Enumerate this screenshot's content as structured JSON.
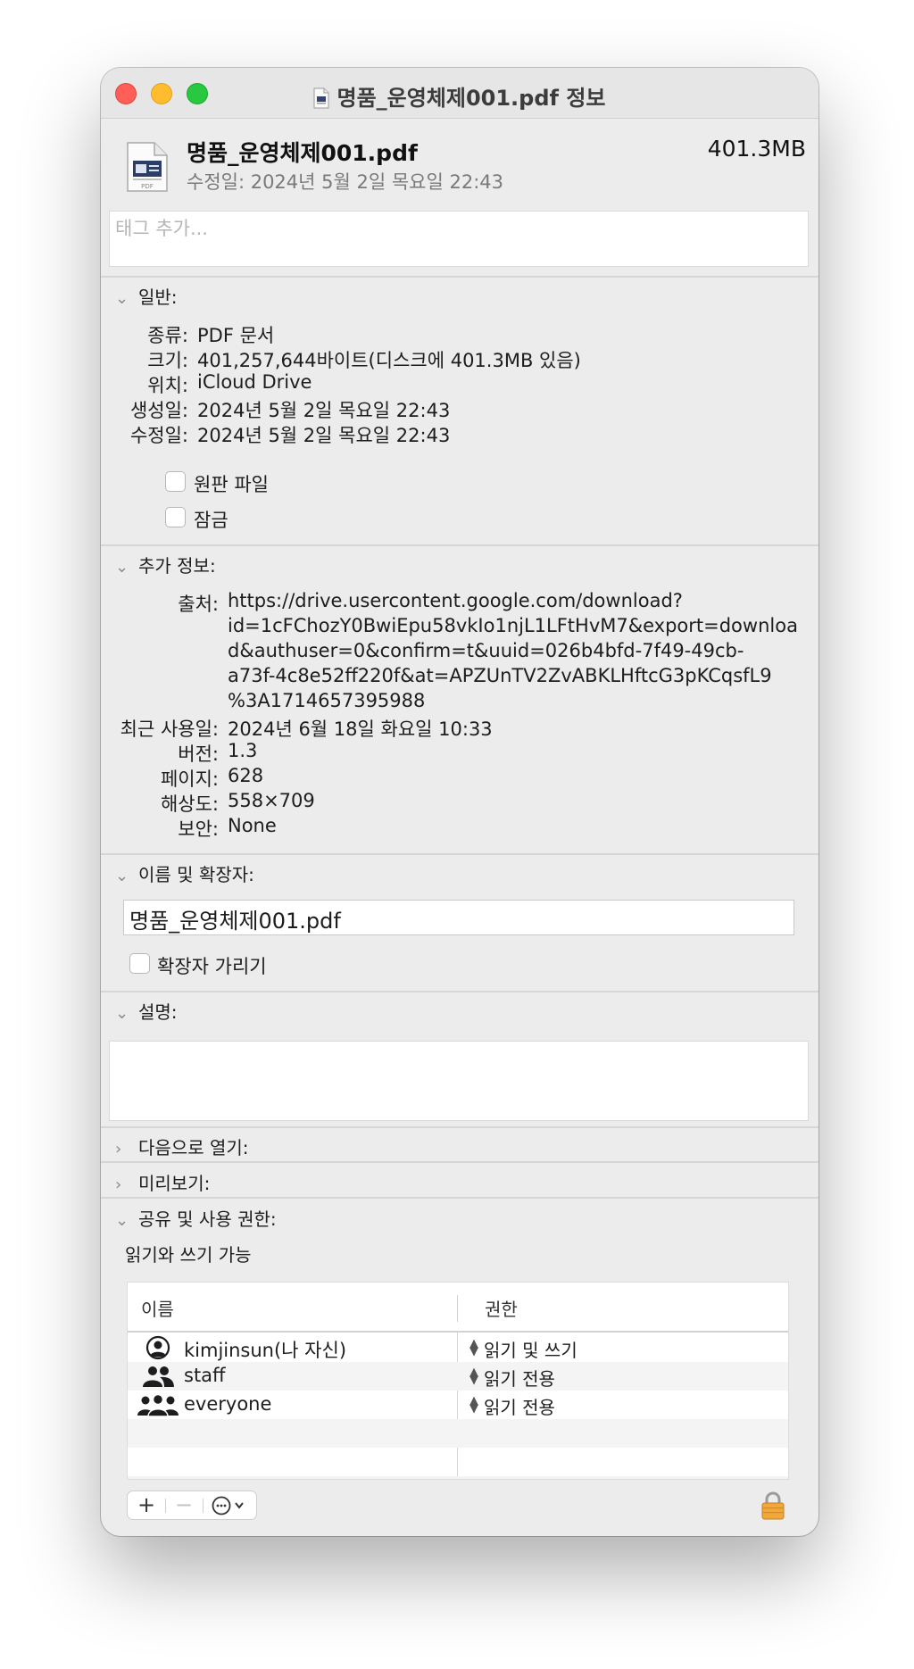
{
  "window": {
    "title": "명품_운영체제001.pdf 정보",
    "traffic_lights": [
      "close",
      "minimize",
      "zoom"
    ]
  },
  "header": {
    "file_name": "명품_운영체제001.pdf",
    "file_size": "401.3MB",
    "modified": "수정일: 2024년 5월 2일 목요일 22:43",
    "file_icon_label": "PDF"
  },
  "tags": {
    "placeholder": "태그 추가..."
  },
  "general": {
    "title": "일반:",
    "rows": [
      {
        "label": "종류:",
        "value": "PDF 문서"
      },
      {
        "label": "크기:",
        "value": "401,257,644바이트(디스크에 401.3MB 있음)"
      },
      {
        "label": "위치:",
        "value": "iCloud Drive"
      },
      {
        "label": "생성일:",
        "value": "2024년 5월 2일 목요일 22:43"
      },
      {
        "label": "수정일:",
        "value": "2024년 5월 2일 목요일 22:43"
      }
    ],
    "stationery_label": "원판 파일",
    "locked_label": "잠금"
  },
  "more_info": {
    "title": "추가 정보:",
    "source_label": "출처:",
    "source_lines": [
      "https://drive.usercontent.google.com/download?",
      "id=1cFChozY0BwiEpu58vkIo1njL1LFtHvM7&export=downloa",
      "d&authuser=0&confirm=t&uuid=026b4bfd-7f49-49cb-",
      "a73f-4c8e52ff220f&at=APZUnTV2ZvABKLHftcG3pKCqsfL9",
      "%3A1714657395988"
    ],
    "rows": [
      {
        "label": "최근 사용일:",
        "value": "2024년 6월 18일 화요일 10:33"
      },
      {
        "label": "버전:",
        "value": "1.3"
      },
      {
        "label": "페이지:",
        "value": "628"
      },
      {
        "label": "해상도:",
        "value": "558×709"
      },
      {
        "label": "보안:",
        "value": "None"
      }
    ]
  },
  "name_ext": {
    "title": "이름 및 확장자:",
    "value": "명품_운영체제001.pdf",
    "hide_ext_label": "확장자 가리기"
  },
  "comments": {
    "title": "설명:"
  },
  "open_with": {
    "title": "다음으로 열기:"
  },
  "preview": {
    "title": "미리보기:"
  },
  "sharing": {
    "title": "공유 및 사용 권한:",
    "status": "읽기와 쓰기 가능",
    "col_name": "이름",
    "col_privilege": "권한",
    "rows": [
      {
        "name": "kimjinsun(나 자신)",
        "privilege": "읽기 및 쓰기",
        "icon": "user-icon"
      },
      {
        "name": "staff",
        "privilege": "읽기 전용",
        "icon": "group-icon"
      },
      {
        "name": "everyone",
        "privilege": "읽기 전용",
        "icon": "everyone-icon"
      }
    ],
    "add_button": "+",
    "remove_button": "−"
  },
  "colors": {
    "close": "#ff5f57",
    "minimize": "#febc2e",
    "zoom": "#28c840",
    "lock": "#f0a73c",
    "window_bg": "#ececec"
  }
}
